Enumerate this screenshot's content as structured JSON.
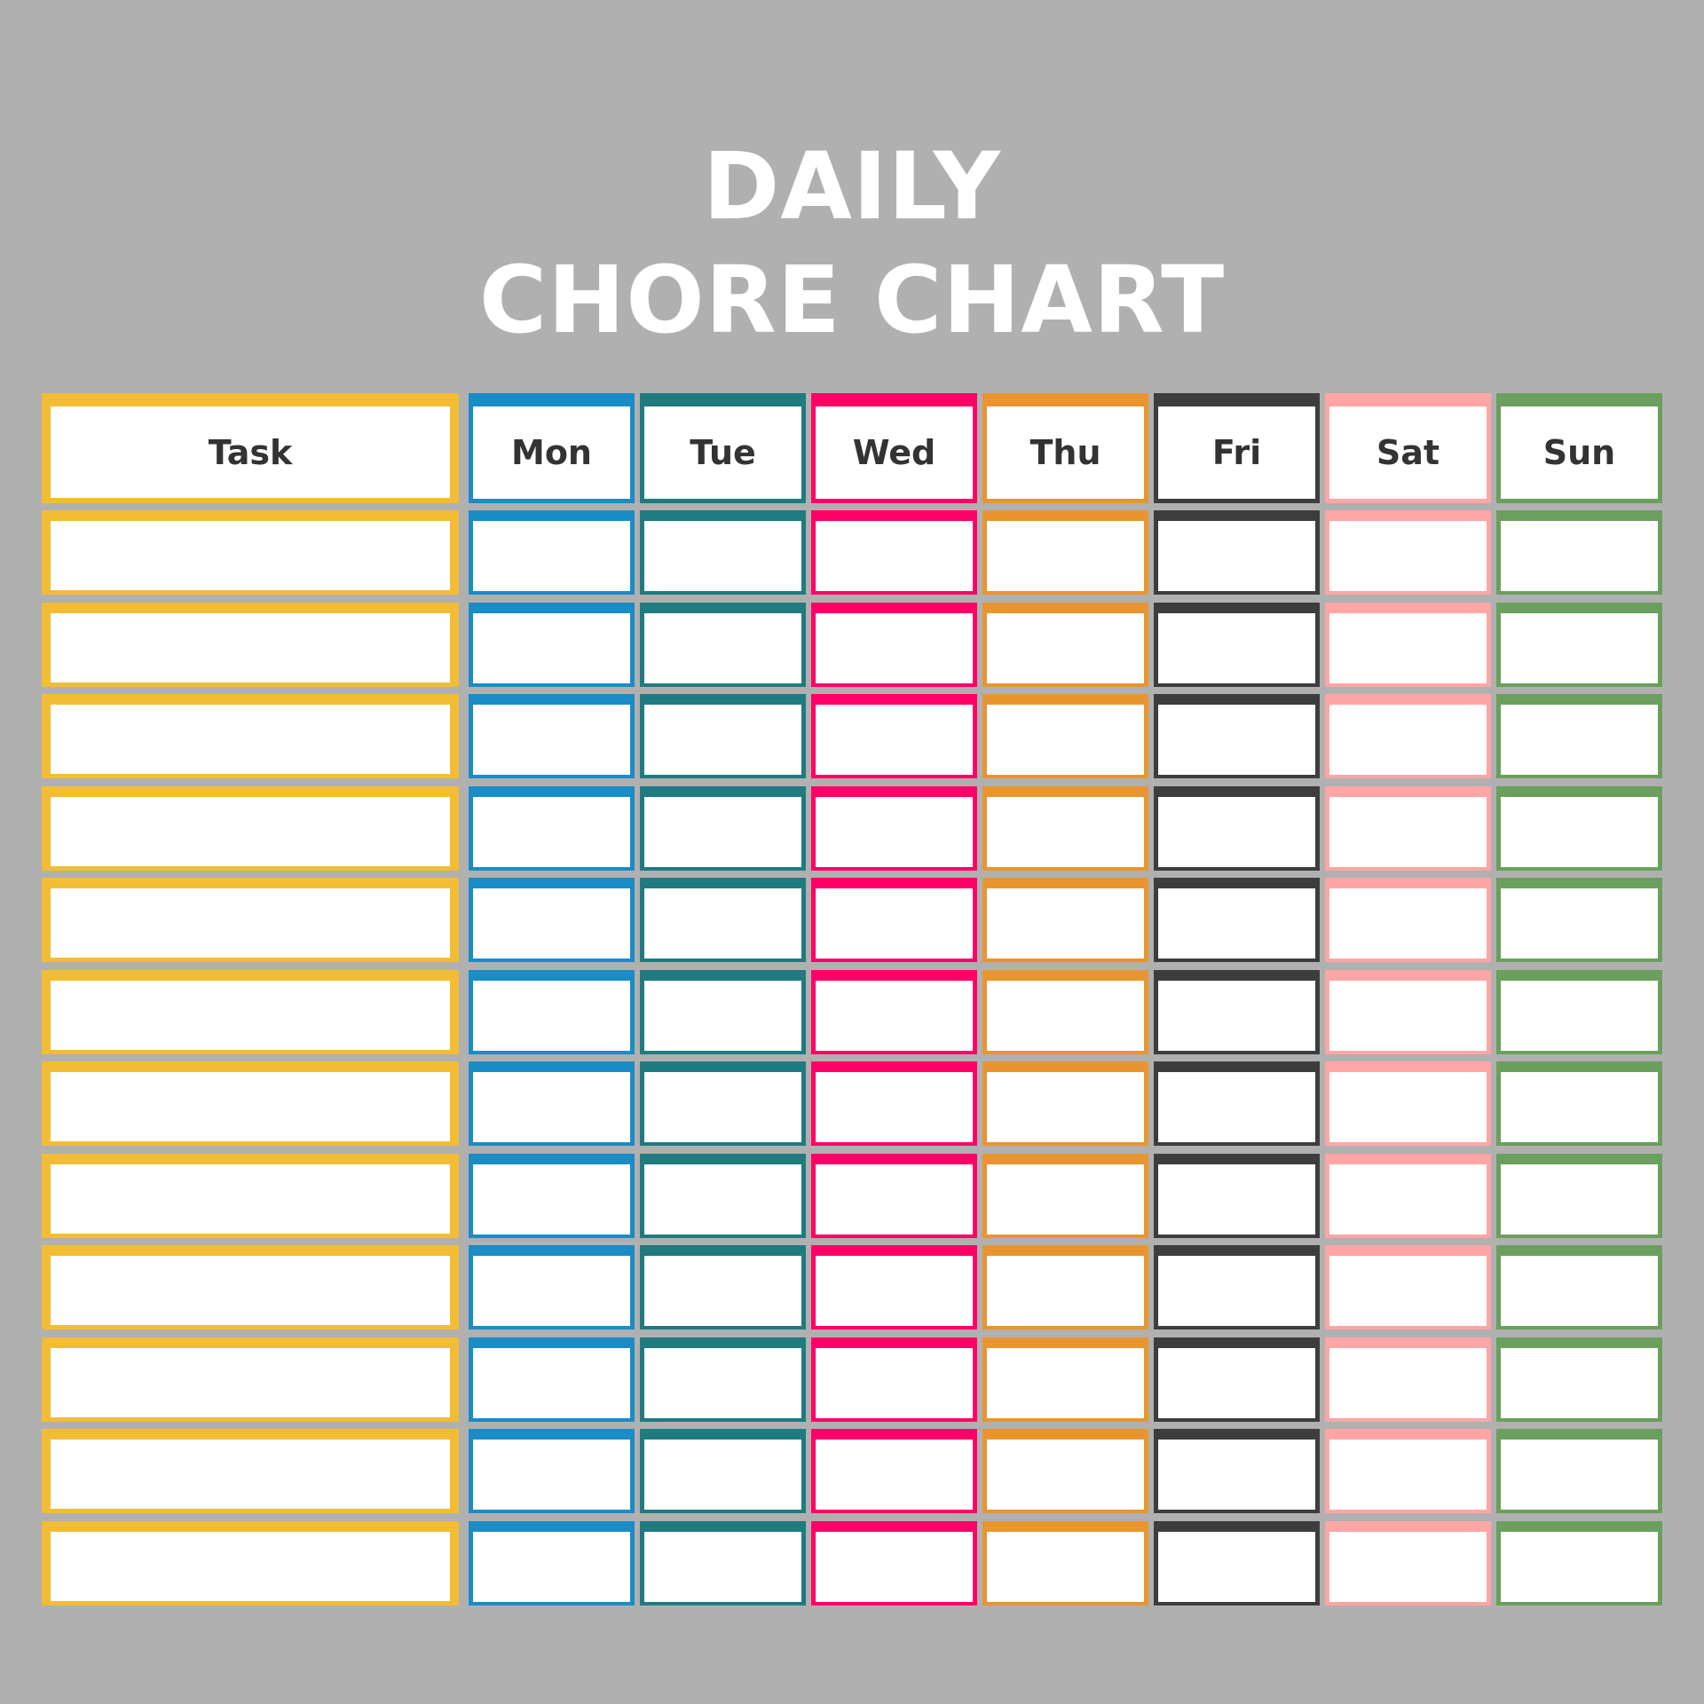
{
  "title": {
    "line1": "DAILY",
    "line2": "CHORE CHART"
  },
  "colors": {
    "background": "#b0b0b0",
    "text": "#333333",
    "title": "#ffffff"
  },
  "columns": [
    {
      "key": "task",
      "label": "Task",
      "color": "#f2bd35"
    },
    {
      "key": "mon",
      "label": "Mon",
      "color": "#1a8cc6"
    },
    {
      "key": "tue",
      "label": "Tue",
      "color": "#1f7b80"
    },
    {
      "key": "wed",
      "label": "Wed",
      "color": "#ff0066"
    },
    {
      "key": "thu",
      "label": "Thu",
      "color": "#e8952f"
    },
    {
      "key": "fri",
      "label": "Fri",
      "color": "#3d3d3d"
    },
    {
      "key": "sat",
      "label": "Sat",
      "color": "#ffa5a5"
    },
    {
      "key": "sun",
      "label": "Sun",
      "color": "#6b9f5e"
    }
  ],
  "rows": [
    {
      "task": "",
      "mon": "",
      "tue": "",
      "wed": "",
      "thu": "",
      "fri": "",
      "sat": "",
      "sun": ""
    },
    {
      "task": "",
      "mon": "",
      "tue": "",
      "wed": "",
      "thu": "",
      "fri": "",
      "sat": "",
      "sun": ""
    },
    {
      "task": "",
      "mon": "",
      "tue": "",
      "wed": "",
      "thu": "",
      "fri": "",
      "sat": "",
      "sun": ""
    },
    {
      "task": "",
      "mon": "",
      "tue": "",
      "wed": "",
      "thu": "",
      "fri": "",
      "sat": "",
      "sun": ""
    },
    {
      "task": "",
      "mon": "",
      "tue": "",
      "wed": "",
      "thu": "",
      "fri": "",
      "sat": "",
      "sun": ""
    },
    {
      "task": "",
      "mon": "",
      "tue": "",
      "wed": "",
      "thu": "",
      "fri": "",
      "sat": "",
      "sun": ""
    },
    {
      "task": "",
      "mon": "",
      "tue": "",
      "wed": "",
      "thu": "",
      "fri": "",
      "sat": "",
      "sun": ""
    },
    {
      "task": "",
      "mon": "",
      "tue": "",
      "wed": "",
      "thu": "",
      "fri": "",
      "sat": "",
      "sun": ""
    },
    {
      "task": "",
      "mon": "",
      "tue": "",
      "wed": "",
      "thu": "",
      "fri": "",
      "sat": "",
      "sun": ""
    },
    {
      "task": "",
      "mon": "",
      "tue": "",
      "wed": "",
      "thu": "",
      "fri": "",
      "sat": "",
      "sun": ""
    },
    {
      "task": "",
      "mon": "",
      "tue": "",
      "wed": "",
      "thu": "",
      "fri": "",
      "sat": "",
      "sun": ""
    },
    {
      "task": "",
      "mon": "",
      "tue": "",
      "wed": "",
      "thu": "",
      "fri": "",
      "sat": "",
      "sun": ""
    },
    {
      "task": "",
      "mon": "",
      "tue": "",
      "wed": "",
      "thu": "",
      "fri": "",
      "sat": "",
      "sun": ""
    }
  ]
}
